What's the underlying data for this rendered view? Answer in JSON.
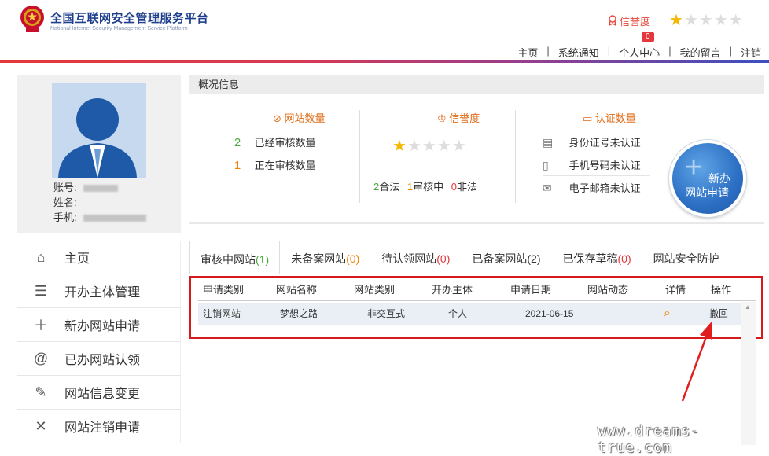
{
  "header": {
    "title": "全国互联网安全管理服务平台",
    "subtitle": "National Internet Security Management Service Platform",
    "credit_label": "信誉度",
    "credit_stars_filled": 1,
    "credit_stars_total": 5,
    "message_badge": "0",
    "nav": [
      "主页",
      "系统通知",
      "个人中心",
      "我的留言",
      "注销"
    ]
  },
  "profile": {
    "account_label": "账号:",
    "name_label": "姓名:",
    "phone_label": "手机:"
  },
  "sidebar": {
    "items": [
      {
        "label": "主页",
        "icon": "home-icon"
      },
      {
        "label": "开办主体管理",
        "icon": "list-icon"
      },
      {
        "label": "新办网站申请",
        "icon": "plus-icon"
      },
      {
        "label": "已办网站认领",
        "icon": "at-icon"
      },
      {
        "label": "网站信息变更",
        "icon": "edit-icon"
      },
      {
        "label": "网站注销申请",
        "icon": "close-icon"
      }
    ]
  },
  "overview": {
    "heading": "概况信息",
    "site_count": {
      "title": "网站数量",
      "approved_num": "2",
      "approved_label": "已经审核数量",
      "pending_num": "1",
      "pending_label": "正在审核数量"
    },
    "credit": {
      "title": "信誉度",
      "stars_filled": 1,
      "stars_total": 5,
      "legal_num": "2",
      "legal_label": "合法",
      "review_num": "1",
      "review_label": "审核中",
      "illegal_num": "0",
      "illegal_label": "非法"
    },
    "auth": {
      "title": "认证数量",
      "id_card": "身份证号未认证",
      "phone": "手机号码未认证",
      "email": "电子邮箱未认证"
    },
    "new_button": {
      "line1": "新办",
      "line2": "网站申请"
    }
  },
  "tabs": [
    {
      "label": "审核中网站",
      "count": "(1)",
      "active": true
    },
    {
      "label": "未备案网站",
      "count": "(0)",
      "active": false
    },
    {
      "label": "待认领网站",
      "count": "(0)",
      "active": false
    },
    {
      "label": "已备案网站",
      "count": "(2)",
      "active": false
    },
    {
      "label": "已保存草稿",
      "count": "(0)",
      "active": false
    },
    {
      "label": "网站安全防护",
      "count": "",
      "active": false
    }
  ],
  "table": {
    "columns": [
      "申请类别",
      "网站名称",
      "网站类别",
      "开办主体",
      "申请日期",
      "网站动态",
      "详情",
      "操作"
    ],
    "rows": [
      {
        "type": "注销网站",
        "name": "梦想之路",
        "category": "非交互式",
        "subject": "个人",
        "date": "2021-06-15",
        "status": "",
        "action": "撤回"
      }
    ]
  },
  "watermark": "www.dreams-true.com"
}
